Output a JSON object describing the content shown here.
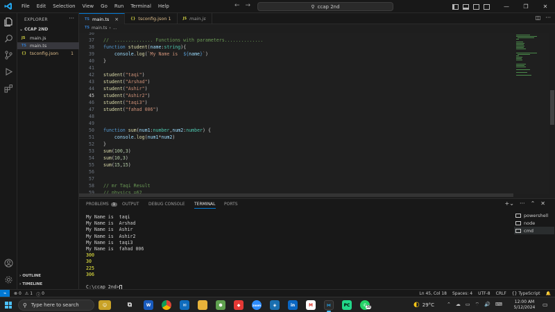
{
  "titlebar": {
    "menu": [
      "File",
      "Edit",
      "Selection",
      "View",
      "Go",
      "Run",
      "Terminal",
      "Help"
    ],
    "command_center": "ccap 2nd"
  },
  "sidebar": {
    "title": "EXPLORER",
    "folder": "CCAP 2ND",
    "files": [
      {
        "type": "JS",
        "name": "main.js",
        "badge": "",
        "color": "#cbcb41"
      },
      {
        "type": "TS",
        "name": "main.ts",
        "badge": "",
        "color": "#3178c6"
      },
      {
        "type": "{}",
        "name": "tsconfig.json",
        "badge": "1",
        "color": "#cbcb41"
      }
    ],
    "outline": "OUTLINE",
    "timeline": "TIMELINE"
  },
  "tabs": [
    {
      "type": "TS",
      "label": "main.ts",
      "active": true
    },
    {
      "type": "{}",
      "label": "tsconfig.json 1",
      "active": false
    },
    {
      "type": "JS",
      "label": "main.js",
      "active": false
    }
  ],
  "breadcrumb": {
    "file_type": "TS",
    "file": "main.ts",
    "rest": "..."
  },
  "editor": {
    "current_line": "45",
    "lines": [
      {
        "n": "36",
        "html": ""
      },
      {
        "n": "37",
        "html": "<span class='c'>//  .............. Functions with parameters..............</span>"
      },
      {
        "n": "38",
        "html": "<span class='k'>function</span> <span class='f'>student</span>(<span class='v'>name</span>:<span class='t'>string</span>){"
      },
      {
        "n": "39",
        "html": "    <span class='v'>console</span>.<span class='f'>log</span>(<span class='s'>`My Name is  </span><span class='k'>${</span><span class='v'>name</span><span class='k'>}</span><span class='s'>`</span>)"
      },
      {
        "n": "40",
        "html": "}"
      },
      {
        "n": "41",
        "html": ""
      },
      {
        "n": "42",
        "html": "<span class='f'>student</span>(<span class='s'>\"taqi\"</span>)"
      },
      {
        "n": "43",
        "html": "<span class='f'>student</span>(<span class='s'>\"Arshad\"</span>)"
      },
      {
        "n": "44",
        "html": "<span class='f'>student</span>(<span class='s'>\"Ashir\"</span>)"
      },
      {
        "n": "45",
        "html": "<span class='f'>student</span>(<span class='s'>\"Ashir2\"</span>)"
      },
      {
        "n": "46",
        "html": "<span class='f'>student</span>(<span class='s'>\"taqi3\"</span>)"
      },
      {
        "n": "47",
        "html": "<span class='f'>student</span>(<span class='s'>\"fahad 006\"</span>)"
      },
      {
        "n": "48",
        "html": ""
      },
      {
        "n": "49",
        "html": ""
      },
      {
        "n": "50",
        "html": "<span class='k'>function</span> <span class='f'>sum</span>(<span class='v'>num1</span>:<span class='t'>number</span>,<span class='v'>num2</span>:<span class='t'>number</span>) {"
      },
      {
        "n": "51",
        "html": "    <span class='v'>console</span>.<span class='f'>log</span>(<span class='v'>num1</span>*<span class='v'>num2</span>)"
      },
      {
        "n": "52",
        "html": "}"
      },
      {
        "n": "53",
        "html": "<span class='f'>sum</span>(<span class='n'>100</span>,<span class='n'>3</span>)"
      },
      {
        "n": "54",
        "html": "<span class='f'>sum</span>(<span class='n'>10</span>,<span class='n'>3</span>)"
      },
      {
        "n": "55",
        "html": "<span class='f'>sum</span>(<span class='n'>15</span>,<span class='n'>15</span>)"
      },
      {
        "n": "56",
        "html": ""
      },
      {
        "n": "57",
        "html": ""
      },
      {
        "n": "58",
        "html": "<span class='c'>// mr Taqi Result</span>"
      },
      {
        "n": "59",
        "html": "<span class='c'>// physics =62</span>"
      }
    ]
  },
  "panel": {
    "tabs": [
      {
        "label": "PROBLEMS",
        "badge": "1"
      },
      {
        "label": "OUTPUT",
        "badge": ""
      },
      {
        "label": "DEBUG CONSOLE",
        "badge": ""
      },
      {
        "label": "TERMINAL",
        "badge": ""
      },
      {
        "label": "PORTS",
        "badge": ""
      }
    ],
    "active_tab": "TERMINAL",
    "output": [
      {
        "text": "My Name is  taqi",
        "num": false
      },
      {
        "text": "My Name is  Arshad",
        "num": false
      },
      {
        "text": "My Name is  Ashir",
        "num": false
      },
      {
        "text": "My Name is  Ashir2",
        "num": false
      },
      {
        "text": "My Name is  taqi3",
        "num": false
      },
      {
        "text": "My Name is  fahad 006",
        "num": false
      },
      {
        "text": "300",
        "num": true
      },
      {
        "text": "30",
        "num": true
      },
      {
        "text": "225",
        "num": true
      },
      {
        "text": "306",
        "num": true
      }
    ],
    "prompt": "C:\\ccap 2nd>",
    "terminals": [
      {
        "label": "powershell",
        "active": false
      },
      {
        "label": "node",
        "active": false
      },
      {
        "label": "cmd",
        "active": true
      }
    ]
  },
  "statusbar": {
    "errors": "0",
    "warnings": "1",
    "info": "0",
    "position": "Ln 45, Col 18",
    "spaces": "Spaces: 4",
    "encoding": "UTF-8",
    "eol": "CRLF",
    "language": "TypeScript"
  },
  "taskbar": {
    "search_placeholder": "Type here to search",
    "temperature": "29°C",
    "time": "12:00 AM",
    "date": "5/12/2024",
    "whatsapp_badge": "38"
  }
}
